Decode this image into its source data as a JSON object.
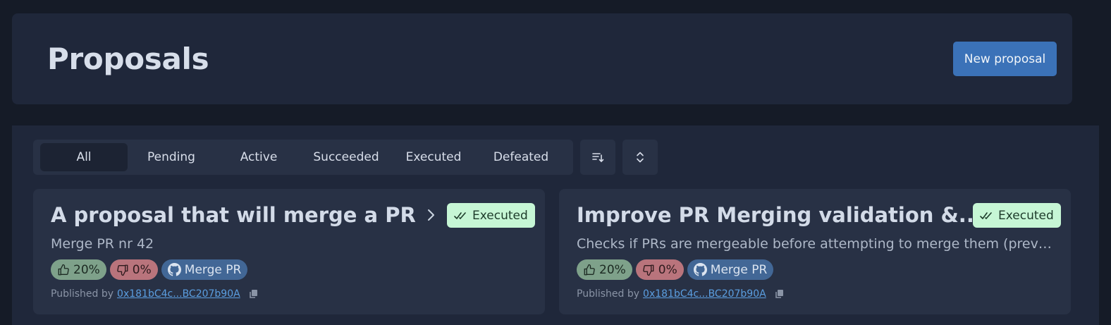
{
  "header": {
    "title": "Proposals",
    "new_button_label": "New proposal"
  },
  "filters": {
    "tabs": [
      {
        "label": "All",
        "selected": true
      },
      {
        "label": "Pending",
        "selected": false
      },
      {
        "label": "Active",
        "selected": false
      },
      {
        "label": "Succeeded",
        "selected": false
      },
      {
        "label": "Executed",
        "selected": false
      },
      {
        "label": "Defeated",
        "selected": false
      }
    ],
    "sort_icon": "sort-descending-icon",
    "expand_icon": "chevron-up-down-icon"
  },
  "proposals": [
    {
      "title": "A proposal that will merge a PR",
      "status": "Executed",
      "description": "Merge PR nr 42",
      "yes_percent": "20%",
      "no_percent": "0%",
      "action_label": "Merge PR",
      "published_prefix": "Published by",
      "publisher": "0x181bC4c...BC207b90A"
    },
    {
      "title": "Improve PR Merging validation &...",
      "status": "Executed",
      "description": "Checks if PRs are mergeable before attempting to merge them (prevents fo...",
      "yes_percent": "20%",
      "no_percent": "0%",
      "action_label": "Merge PR",
      "published_prefix": "Published by",
      "publisher": "0x181bC4c...BC207b90A"
    }
  ],
  "colors": {
    "background": "#151b27",
    "panel": "#1f273a",
    "card": "#283145",
    "accent": "#3b72b8",
    "executed_badge": "#c6f6d5",
    "vote_yes": "#7ea18a",
    "vote_no": "#b9747c",
    "action_pill": "#426796",
    "link": "#5b9ee0"
  }
}
